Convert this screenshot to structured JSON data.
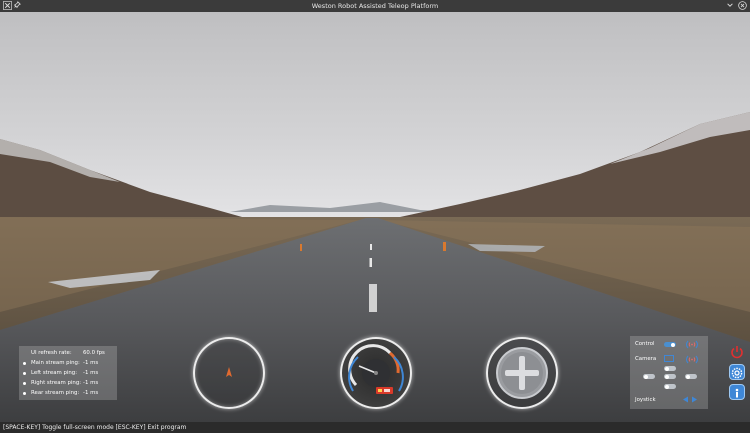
{
  "window": {
    "title": "Weston Robot Assisted Teleop Platform",
    "icons": [
      "x-logo-icon",
      "pin-icon",
      "chevron-down-icon",
      "close-circle-icon"
    ]
  },
  "stats": [
    {
      "label": "UI refresh rate:",
      "value": "60.0 fps",
      "bullet": false
    },
    {
      "label": "Main stream ping:",
      "value": "-1 ms",
      "bullet": true
    },
    {
      "label": "Left stream ping:",
      "value": "-1 ms",
      "bullet": true
    },
    {
      "label": "Right stream ping:",
      "value": "-1 ms",
      "bullet": true
    },
    {
      "label": "Rear stream ping:",
      "value": "-1 ms",
      "bullet": true
    }
  ],
  "control_panel": {
    "control_label": "Control",
    "camera_label": "Camera",
    "joystick_label": "Joystick"
  },
  "status_bar": "[SPACE-KEY] Toggle full-screen mode [ESC-KEY] Exit program",
  "colors": {
    "accent": "#3f87d6",
    "power": "#e03030",
    "gauge_warning": "#e06a30",
    "battery": "#d93a2a"
  },
  "side_buttons": [
    "power-icon",
    "settings-icon",
    "info-icon"
  ]
}
